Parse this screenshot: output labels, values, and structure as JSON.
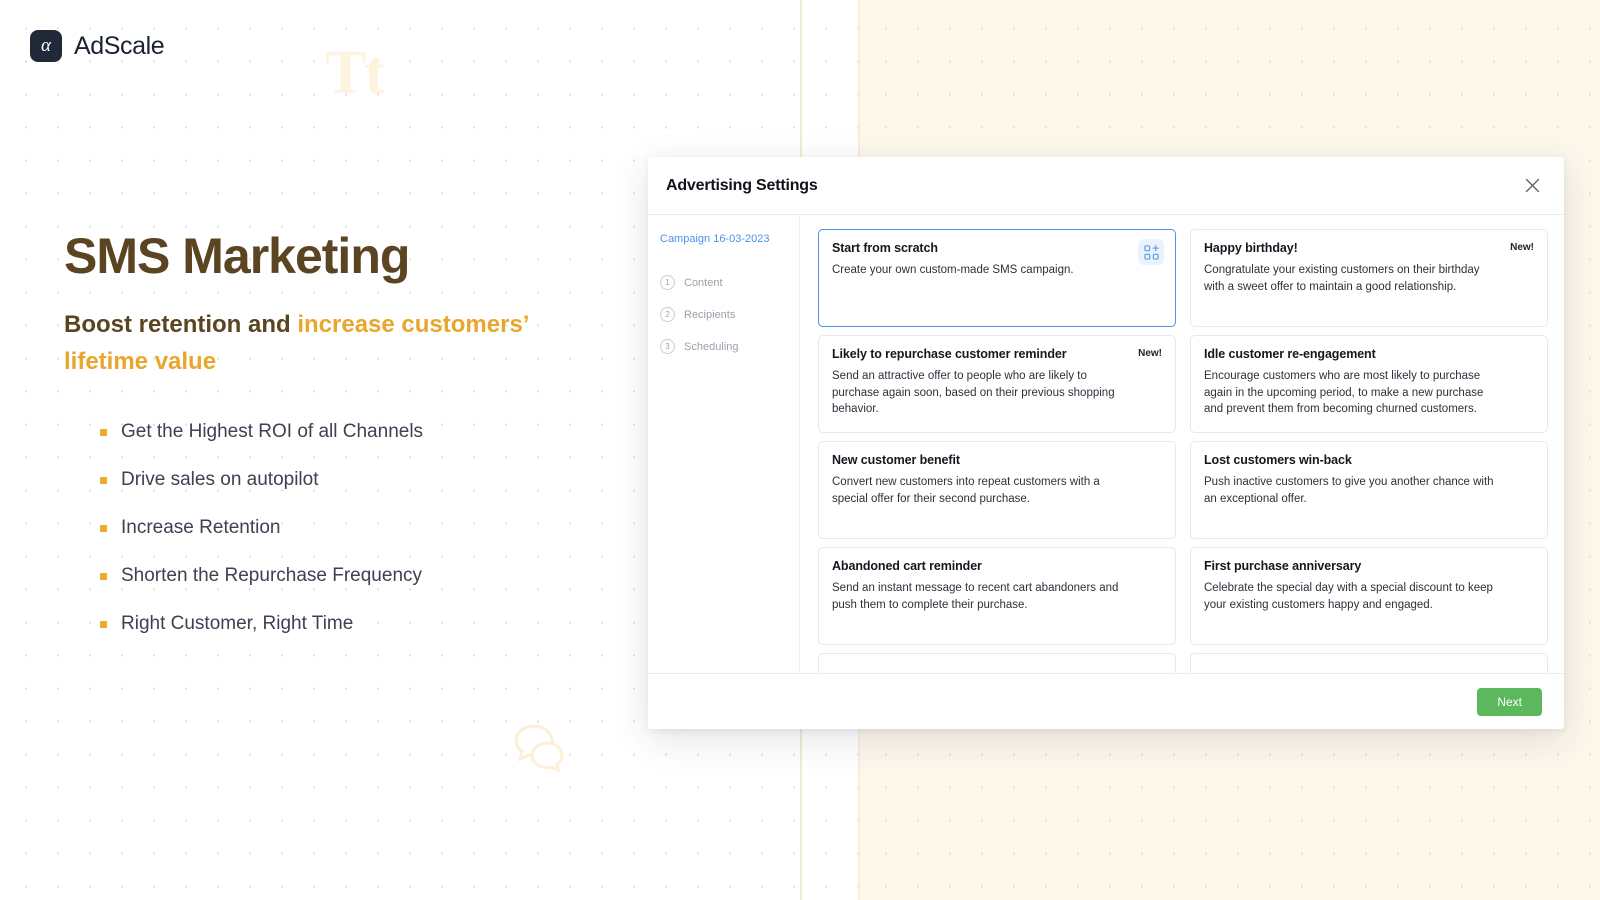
{
  "brand": {
    "logo_mark_glyph": "α",
    "logo_text": "AdScale",
    "logo_icon_name": "alpha-logo-icon",
    "mark_color": "#1f2937"
  },
  "decor": {
    "watermark_text": "Tt",
    "chat_icon_name": "chat-bubbles-icon",
    "cream_color": "#fdf8ec",
    "accent_color": "#e8a72c"
  },
  "hero": {
    "title": "SMS Marketing",
    "subtitle_plain": "Boost retention and ",
    "subtitle_accent": "increase customers’ lifetime value",
    "bullets": [
      "Get the Highest ROI of all Channels",
      "Drive sales on autopilot",
      "Increase Retention",
      "Shorten the Repurchase Frequency",
      "Right Customer, Right Time"
    ]
  },
  "modal": {
    "title": "Advertising Settings",
    "close_label": "✕",
    "sidebar": {
      "campaign_name": "Campaign 16-03-2023",
      "steps": [
        {
          "num": "1",
          "label": "Content"
        },
        {
          "num": "2",
          "label": "Recipients"
        },
        {
          "num": "3",
          "label": "Scheduling"
        }
      ]
    },
    "cards": [
      {
        "title": "Start from scratch",
        "desc": "Create your own custom-made SMS campaign.",
        "badge": "",
        "selected": true,
        "icon": "grid-plus-icon"
      },
      {
        "title": "Happy birthday!",
        "desc": "Congratulate your existing customers on their birthday with a sweet offer to maintain a good relationship.",
        "badge": "New!",
        "selected": false,
        "icon": ""
      },
      {
        "title": "Likely to repurchase customer reminder",
        "desc": "Send an attractive offer to people who are likely to purchase again soon, based on their previous shopping behavior.",
        "badge": "New!",
        "selected": false,
        "icon": ""
      },
      {
        "title": "Idle customer re-engagement",
        "desc": "Encourage customers who are most likely to purchase again in the upcoming period, to make a new purchase and prevent them from becoming churned customers.",
        "badge": "",
        "selected": false,
        "icon": ""
      },
      {
        "title": "New customer benefit",
        "desc": "Convert new customers into repeat customers with a special offer for their second purchase.",
        "badge": "",
        "selected": false,
        "icon": ""
      },
      {
        "title": "Lost customers win-back",
        "desc": "Push inactive customers to give you another chance with an exceptional offer.",
        "badge": "",
        "selected": false,
        "icon": ""
      },
      {
        "title": "Abandoned cart reminder",
        "desc": "Send an instant message to recent cart abandoners and push them to complete their purchase.",
        "badge": "",
        "selected": false,
        "icon": ""
      },
      {
        "title": "First purchase anniversary",
        "desc": "Celebrate the special day with a special discount to keep your existing customers happy and engaged.",
        "badge": "",
        "selected": false,
        "icon": ""
      },
      {
        "title": "",
        "desc": "",
        "badge": "",
        "selected": false,
        "icon": ""
      },
      {
        "title": "",
        "desc": "",
        "badge": "",
        "selected": false,
        "icon": ""
      }
    ],
    "footer": {
      "next_label": "Next",
      "next_color": "#5cb85c"
    }
  }
}
